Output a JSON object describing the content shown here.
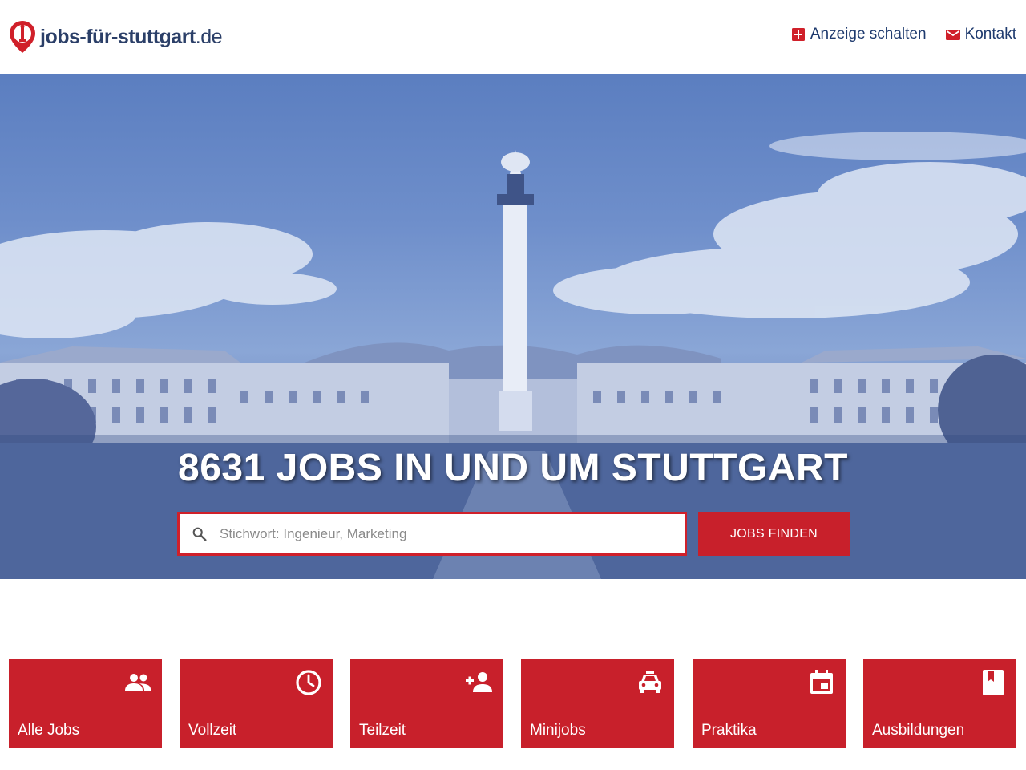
{
  "logo": {
    "name": "jobs-für-stuttgart",
    "tld": ".de"
  },
  "nav": {
    "items": [
      {
        "label": "Anzeige schalten",
        "icon": "add-box-icon"
      },
      {
        "label": "Kontakt",
        "icon": "mail-icon"
      }
    ]
  },
  "hero": {
    "title": "8631 JOBS IN UND UM STUTTGART",
    "search_placeholder": "Stichwort: Ingenieur, Marketing",
    "search_button": "JOBS FINDEN"
  },
  "categories": [
    {
      "label": "Alle Jobs",
      "icon": "people-icon"
    },
    {
      "label": "Vollzeit",
      "icon": "clock-icon"
    },
    {
      "label": "Teilzeit",
      "icon": "person-add-icon"
    },
    {
      "label": "Minijobs",
      "icon": "car-icon"
    },
    {
      "label": "Praktika",
      "icon": "calendar-icon"
    },
    {
      "label": "Ausbildungen",
      "icon": "book-icon"
    }
  ],
  "colors": {
    "brand_red": "#c8202b",
    "brand_blue": "#2b3f68",
    "hero_tint": "#5b7ec0"
  }
}
